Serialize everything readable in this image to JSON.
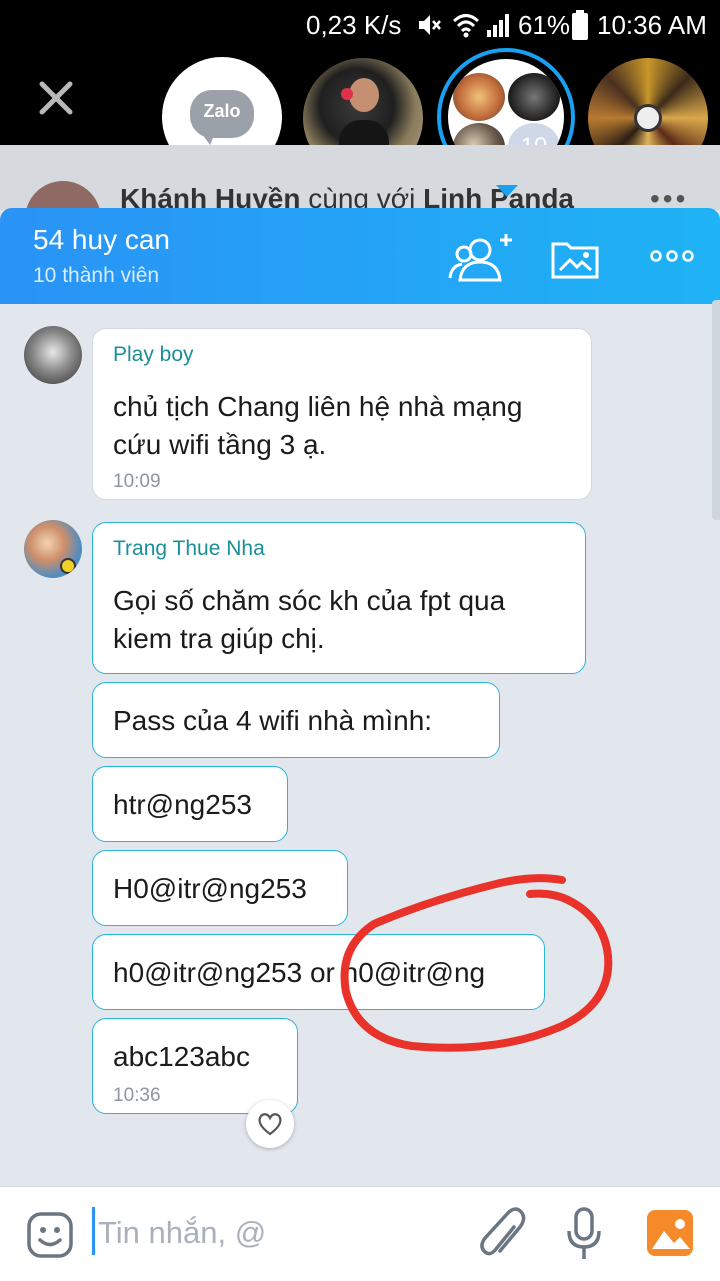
{
  "status": {
    "speed": "0,23 K/s",
    "battery": "61%",
    "time": "10:36 AM"
  },
  "chat_heads": {
    "group_count": "10",
    "zalo_label": "Zalo"
  },
  "behind": {
    "name1": "Khánh Huyền",
    "connector": " cùng với ",
    "name2": "Linh Panda"
  },
  "header": {
    "title": "54 huy can",
    "subtitle": "10 thành viên"
  },
  "messages": {
    "m1": {
      "sender": "Play boy",
      "line1": "chủ tịch Chang liên hệ nhà mạng",
      "line2": "cứu wifi tầng 3 ạ.",
      "time": "10:09"
    },
    "m2": {
      "sender": "Trang Thue Nha",
      "line1": "Gọi số chăm sóc kh của fpt qua",
      "line2": "kiem tra giúp chị."
    },
    "m3": {
      "text": "Pass của 4 wifi nhà mình:"
    },
    "m4": {
      "text": "htr@ng253"
    },
    "m5": {
      "text": "H0@itr@ng253"
    },
    "m6": {
      "text": "h0@itr@ng253 or h0@itr@ng"
    },
    "m7": {
      "text": "abc123abc",
      "time": "10:36"
    }
  },
  "input": {
    "placeholder": "Tin nhắn, @"
  },
  "colors": {
    "header_start": "#2a93f6",
    "header_end": "#1fb3f5",
    "sender": "#1a8f98",
    "bubble_border": "#27b4d8",
    "annotation": "#e8322a"
  }
}
